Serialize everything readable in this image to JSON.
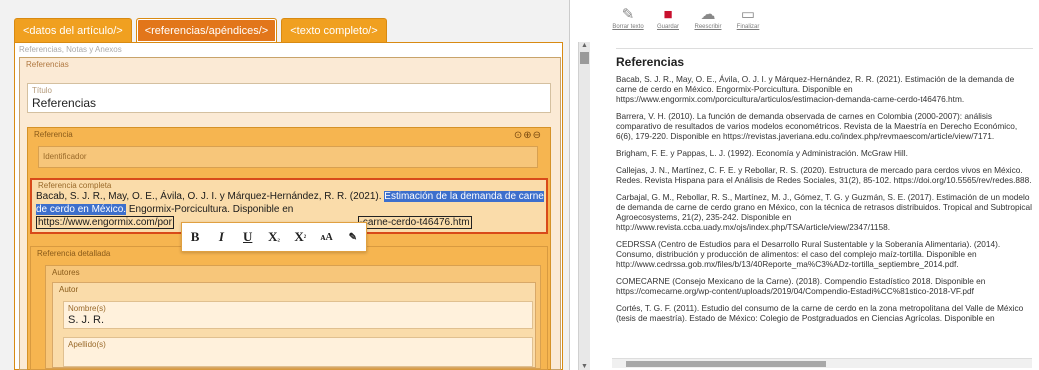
{
  "tabs": [
    {
      "label": "<datos del artículo/>"
    },
    {
      "label": "<referencias/apéndices/>"
    },
    {
      "label": "<texto completo/>"
    }
  ],
  "editor": {
    "section_heading": "Referencias, Notas y Anexos",
    "referencias_label": "Referencias",
    "titulo_label": "Título",
    "titulo_value": "Referencias",
    "referencia_label": "Referencia",
    "controls": "⊙⊕⊖",
    "identificador_label": "Identificador",
    "ref_completa_label": "Referencia completa",
    "ref_text_a": "Bacab, S. J. R., May, O. E., Ávila, O. J. I. y Márquez-Hernández, R. R. (2021).",
    "ref_text_sel": "Estimación de la demanda de carne de cerdo en México.",
    "ref_text_b": "Engormix-Porcicultura. Disponible en",
    "ref_url_start": "https://www.engormix.com/por",
    "ref_url_end": "-carne-cerdo-t46476.htm",
    "ref_detallada_label": "Referencia detallada",
    "autores_label": "Autores",
    "autor_label": "Autor",
    "nombres_label": "Nombre(s)",
    "nombres_value": "S. J. R.",
    "apellidos_label": "Apellido(s)"
  },
  "format_toolbar": {
    "bold": "B",
    "italic": "I",
    "underline": "U",
    "subscript": "X",
    "sub_mark": "₂",
    "superscript": "X",
    "sup_mark": "²",
    "smallcaps": "ᴀA",
    "clear": "✎"
  },
  "right_toolbar": [
    {
      "label": "Borrar texto",
      "icon": "eraser-icon"
    },
    {
      "label": "Guardar",
      "icon": "save-icon"
    },
    {
      "label": "Reescribir",
      "icon": "cloud-icon"
    },
    {
      "label": "Finalizar",
      "icon": "document-icon"
    }
  ],
  "preview": {
    "title": "Referencias",
    "entries": [
      "Bacab, S. J. R., May, O. E., Ávila, O. J. I. y Márquez-Hernández, R. R. (2021). Estimación de la demanda de carne de cerdo en México. Engormix-Porcicultura. Disponible en https://www.engormix.com/porcicultura/articulos/estimacion-demanda-carne-cerdo-t46476.htm.",
      "Barrera, V. H. (2010). La función de demanda observada de carnes en Colombia (2000-2007): análisis comparativo de resultados de varios modelos econométricos. Revista de la Maestría en Derecho Económico, 6(6), 179-220. Disponible en https://revistas.javeriana.edu.co/index.php/revmaescom/article/view/7171.",
      "Brigham, F. E. y Pappas, L. J. (1992). Economía y Administración. McGraw Hill.",
      "Callejas, J. N., Martínez, C. F. E. y Rebollar, R. S. (2020). Estructura de mercado para cerdos vivos en México. Redes. Revista Hispana para el Análisis de Redes Sociales, 31(2), 85-102. https://doi.org/10.5565/rev/redes.888.",
      "Carbajal, G. M., Rebollar, R. S., Martínez, M. J., Gómez, T. G. y Guzmán, S. E. (2017). Estimación de un modelo de demanda de carne de cerdo grano en México, con la técnica de retrasos distribuidos. Tropical and Subtropical Agroecosystems, 21(2), 235-242. Disponible en http://www.revista.ccba.uady.mx/ojs/index.php/TSA/article/view/2347/1158.",
      "CEDRSSA (Centro de Estudios para el Desarrollo Rural Sustentable y la Soberanía Alimentaria). (2014). Consumo, distribución y producción de alimentos: el caso del complejo maíz-tortilla. Disponible en http://www.cedrssa.gob.mx/files/b/13/40Reporte_ma%C3%ADz-tortilla_septiembre_2014.pdf.",
      "COMECARNE (Consejo Mexicano de la Carne). (2018). Compendio Estadístico 2018. Disponible en https://comecarne.org/wp-content/uploads/2019/04/Compendio-Estadi%CC%81stico-2018-VF.pdf",
      "Cortés, T. G. F. (2011). Estudio del consumo de la carne de cerdo en la zona metropolitana del Valle de México (tesis de maestría). Estado de México: Colegio de Postgraduados en Ciencias Agrícolas. Disponible en"
    ]
  }
}
